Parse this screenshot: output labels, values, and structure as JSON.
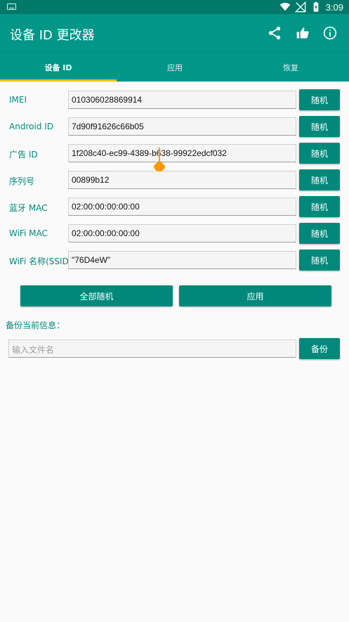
{
  "status_bar": {
    "time": "3:09",
    "icons": [
      "keyboard-icon",
      "wifi-icon",
      "no-signal-icon",
      "battery-charging-icon"
    ]
  },
  "app_bar": {
    "title": "设备 ID 更改器",
    "actions": [
      "share-icon",
      "thumbs-up-icon",
      "info-icon"
    ]
  },
  "tabs": [
    {
      "label": "设备 ID",
      "active": true
    },
    {
      "label": "应用",
      "active": false
    },
    {
      "label": "恢复",
      "active": false
    }
  ],
  "fields": [
    {
      "label": "IMEI",
      "value": "010306028869914",
      "button": "随机"
    },
    {
      "label": "Android ID",
      "value": "7d90f91626c66b05",
      "button": "随机"
    },
    {
      "label": "广告 ID",
      "value": "1f208c40-ec99-4389-b638-99922edcf032",
      "button": "随机"
    },
    {
      "label": "序列号",
      "value": "00899b12",
      "button": "随机"
    },
    {
      "label": "蓝牙 MAC",
      "value": "02:00:00:00:00:00",
      "button": "随机"
    },
    {
      "label": "WiFi MAC",
      "value": "02:00:00:00:00:00",
      "button": "随机"
    },
    {
      "label": "WiFi 名称(SSID)",
      "value": "\"76D4eW\"",
      "button": "随机"
    }
  ],
  "actions": {
    "randomize_all": "全部随机",
    "apply": "应用"
  },
  "backup": {
    "label": "备份当前信息：",
    "placeholder": "输入文件名",
    "button": "备份"
  },
  "colors": {
    "primary": "#009688",
    "primary_dark": "#00796b",
    "button": "#00897b",
    "indicator": "#ffc107",
    "cursor": "#ff9800"
  }
}
